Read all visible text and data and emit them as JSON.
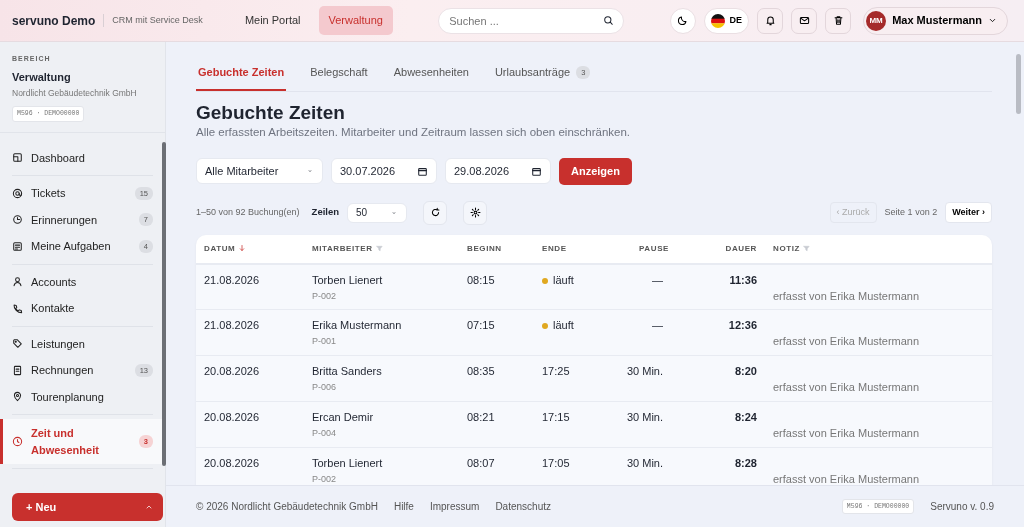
{
  "topbar": {
    "brand": "servuno Demo",
    "brand_sub": "CRM mit Service Desk",
    "nav": [
      {
        "label": "Mein Portal",
        "selected": false
      },
      {
        "label": "Verwaltung",
        "selected": true
      }
    ],
    "search": {
      "placeholder": "Suchen ..."
    },
    "language": "DE",
    "user": {
      "initials": "MM",
      "name": "Max Mustermann"
    }
  },
  "sidebar": {
    "section_label": "BEREICH",
    "title": "Verwaltung",
    "company": "Nordlicht Gebäudetechnik GmbH",
    "code": "M596 · DEMO00000",
    "groups": [
      [
        {
          "label": "Dashboard",
          "selected": false
        }
      ],
      [
        {
          "label": "Tickets",
          "count": "15",
          "selected": false
        },
        {
          "label": "Erinnerungen",
          "count": "7",
          "selected": false
        },
        {
          "label": "Meine Aufgaben",
          "count": "4",
          "selected": false
        }
      ],
      [
        {
          "label": "Accounts",
          "selected": false
        },
        {
          "label": "Kontakte",
          "selected": false
        }
      ],
      [
        {
          "label": "Leistungen",
          "selected": false
        },
        {
          "label": "Rechnungen",
          "count": "13",
          "selected": false
        },
        {
          "label": "Tourenplanung",
          "selected": false
        }
      ],
      [
        {
          "label": "Zeit und Abwesenheit",
          "count": "3",
          "selected": true
        }
      ]
    ],
    "new_button": "+ Neu"
  },
  "tabs": [
    {
      "label": "Gebuchte Zeiten",
      "selected": true
    },
    {
      "label": "Belegschaft",
      "selected": false
    },
    {
      "label": "Abwesenheiten",
      "selected": false
    },
    {
      "label": "Urlaubsanträge",
      "count": "3",
      "selected": false
    }
  ],
  "heading": "Gebuchte Zeiten",
  "subtitle": "Alle erfassten Arbeitszeiten. Mitarbeiter und Zeitraum lassen sich oben einschränken.",
  "filters": {
    "employee": "Alle Mitarbeiter",
    "date_from": "30.07.2026",
    "date_to": "29.08.2026",
    "submit": "Anzeigen"
  },
  "summary": "1–50 von 92 Buchung(en)",
  "rows_label": "Zeilen",
  "rows_value": "50",
  "pagination": {
    "prev": {
      "label": "‹ Zurück",
      "disabled": true
    },
    "page": "Seite 1 von 2",
    "next": {
      "label": "Weiter ›",
      "disabled": false
    }
  },
  "table": {
    "columns": [
      {
        "label": "DATUM",
        "kind": "sorted"
      },
      {
        "label": "MITARBEITER",
        "kind": "filter"
      },
      {
        "label": "BEGINN",
        "kind": "plain"
      },
      {
        "label": "ENDE",
        "kind": "plain"
      },
      {
        "label": "PAUSE",
        "kind": "plain"
      },
      {
        "label": "DAUER",
        "kind": "plain"
      },
      {
        "label": "NOTIZ",
        "kind": "filter"
      }
    ],
    "rows": [
      {
        "date": "21.08.2026",
        "employee": "Torben Lienert",
        "employee_id": "P-002",
        "start": "08:15",
        "end": "läuft",
        "running": true,
        "pause": "—",
        "duration": "11:36",
        "note": "erfasst von Erika Mustermann"
      },
      {
        "date": "21.08.2026",
        "employee": "Erika Mustermann",
        "employee_id": "P-001",
        "start": "07:15",
        "end": "läuft",
        "running": true,
        "pause": "—",
        "duration": "12:36",
        "note": "erfasst von Erika Mustermann"
      },
      {
        "date": "20.08.2026",
        "employee": "Britta Sanders",
        "employee_id": "P-006",
        "start": "08:35",
        "end": "17:25",
        "running": false,
        "pause": "30 Min.",
        "duration": "8:20",
        "note": "erfasst von Erika Mustermann"
      },
      {
        "date": "20.08.2026",
        "employee": "Ercan Demir",
        "employee_id": "P-004",
        "start": "08:21",
        "end": "17:15",
        "running": false,
        "pause": "30 Min.",
        "duration": "8:24",
        "note": "erfasst von Erika Mustermann"
      },
      {
        "date": "20.08.2026",
        "employee": "Torben Lienert",
        "employee_id": "P-002",
        "start": "08:07",
        "end": "17:05",
        "running": false,
        "pause": "30 Min.",
        "duration": "8:28",
        "note": "erfasst von Erika Mustermann"
      }
    ]
  },
  "footer": {
    "copyright": "© 2026 Nordlicht Gebäudetechnik GmbH",
    "links": [
      "Hilfe",
      "Impressum",
      "Datenschutz"
    ],
    "code": "M596 · DEMO00000",
    "version": "Servuno v. 0.9"
  }
}
